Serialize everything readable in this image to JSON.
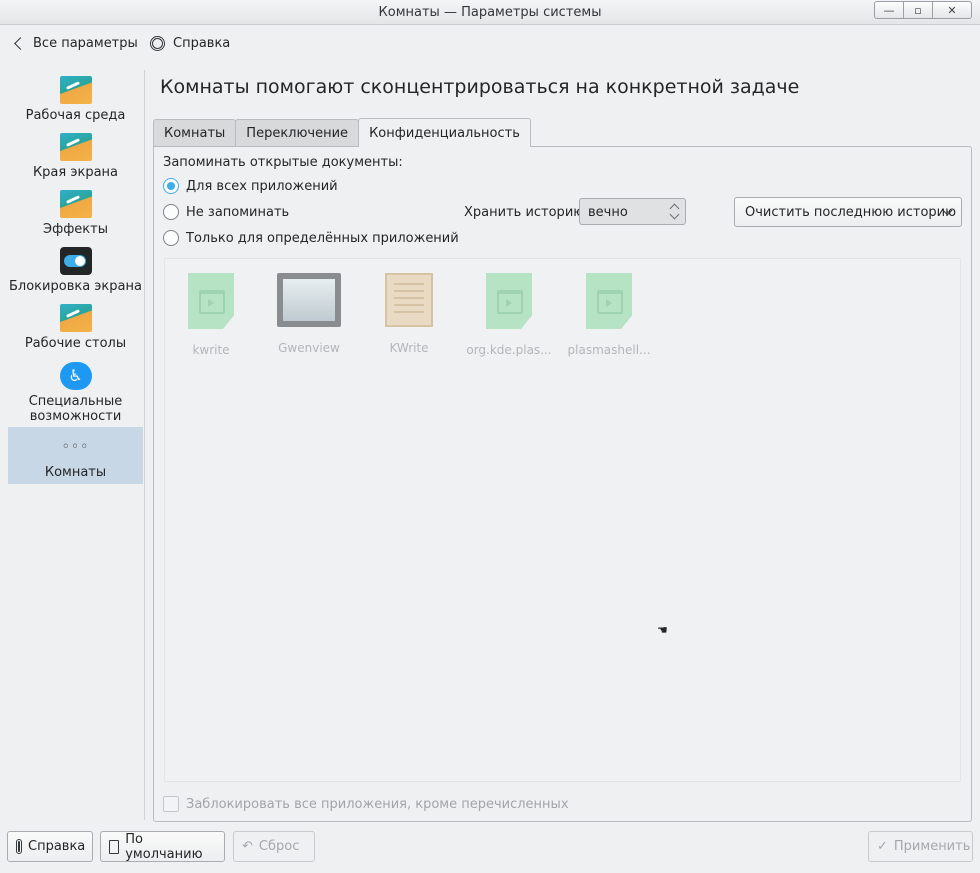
{
  "window": {
    "title": "Комнаты  — Параметры системы",
    "controls": {
      "minimize": "—",
      "maximize": "▫",
      "close": "✕"
    }
  },
  "toolbar": {
    "back_label": "Все параметры",
    "help_label": "Справка"
  },
  "sidebar": {
    "items": [
      {
        "label": "Рабочая среда",
        "icon": "desktop-icon"
      },
      {
        "label": "Края экрана",
        "icon": "screen-edges-icon"
      },
      {
        "label": "Эффекты",
        "icon": "effects-icon"
      },
      {
        "label": "Блокировка экрана",
        "icon": "toggle-icon"
      },
      {
        "label": "Рабочие столы",
        "icon": "virtual-desktops-icon"
      },
      {
        "label": "Специальные возможности",
        "icon": "accessibility-icon"
      },
      {
        "label": "Комнаты",
        "icon": "dots-icon",
        "active": true,
        "icon_glyph": "◦◦◦"
      }
    ]
  },
  "main": {
    "heading": "Комнаты помогают сконцентрироваться на конкретной задаче",
    "tabs": [
      {
        "label": "Комнаты"
      },
      {
        "label": "Переключение"
      },
      {
        "label": "Конфиденциальность",
        "active": true
      }
    ],
    "privacy": {
      "remember_label": "Запоминать открытые документы:",
      "options": [
        {
          "label": "Для всех приложений",
          "checked": true
        },
        {
          "label": "Не запоминать",
          "checked": false
        },
        {
          "label": "Только для определённых приложений",
          "checked": false
        }
      ],
      "keep_history_label": "Хранить историю",
      "keep_history_value": "вечно",
      "clear_button": "Очистить последнюю историю",
      "apps": [
        {
          "name": "kwrite",
          "icon": "document-icon"
        },
        {
          "name": "Gwenview",
          "icon": "gwenview-icon"
        },
        {
          "name": "KWrite",
          "icon": "kwrite-icon"
        },
        {
          "name": "org.kde.plas...",
          "icon": "document-icon"
        },
        {
          "name": "plasmashell...",
          "icon": "document-icon"
        }
      ],
      "block_all_label": "Заблокировать все приложения, кроме перечисленных"
    }
  },
  "footer": {
    "help": "Справка",
    "defaults": "По умолчанию",
    "reset": "Сброс",
    "apply": "Применить"
  }
}
